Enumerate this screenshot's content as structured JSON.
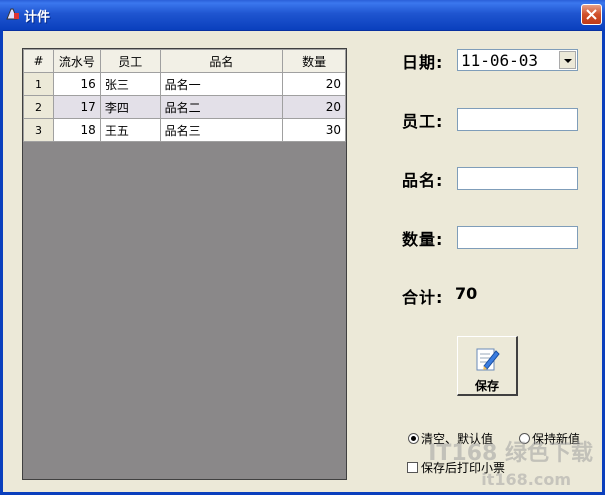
{
  "window": {
    "title": "计件"
  },
  "grid": {
    "columns": [
      "#",
      "流水号",
      "员工",
      "品名",
      "数量"
    ],
    "rows": [
      {
        "num": "1",
        "serial": "16",
        "employee": "张三",
        "product": "品名一",
        "qty": "20"
      },
      {
        "num": "2",
        "serial": "17",
        "employee": "李四",
        "product": "品名二",
        "qty": "20"
      },
      {
        "num": "3",
        "serial": "18",
        "employee": "王五",
        "product": "品名三",
        "qty": "30"
      }
    ]
  },
  "form": {
    "date_label": "日期:",
    "date_value": "11-06-03",
    "employee_label": "员工:",
    "employee_value": "",
    "product_label": "品名:",
    "product_value": "",
    "qty_label": "数量:",
    "qty_value": "",
    "total_label": "合计:",
    "total_value": "70"
  },
  "save_button": {
    "label": "保存",
    "icon": "document-pen-icon"
  },
  "options": {
    "clear_default": "清空、默认值",
    "keep_new": "保持新值",
    "print_after_save": "保存后打印小票"
  },
  "watermark": {
    "line1": "IT168 绿色下载",
    "line2": "it168.com"
  }
}
